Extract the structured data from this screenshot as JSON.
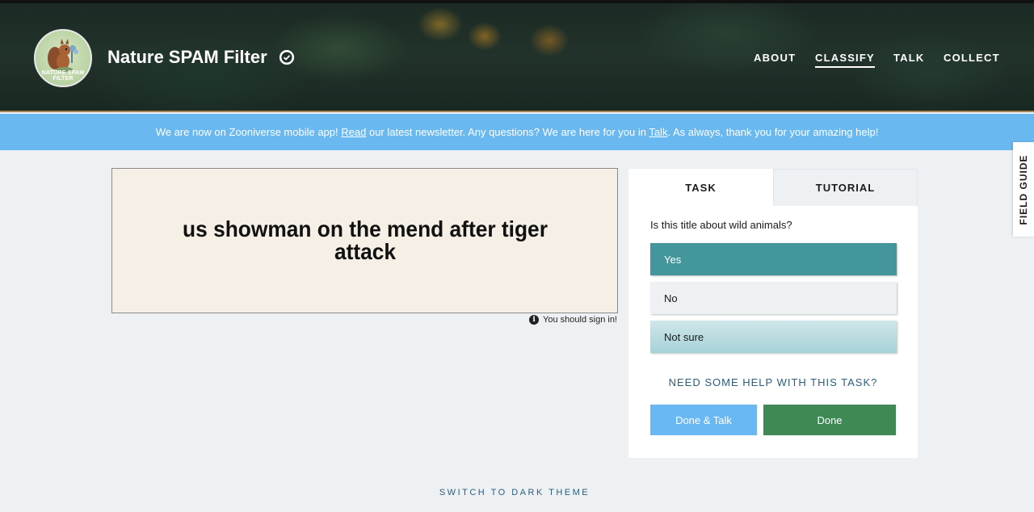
{
  "header": {
    "project_title": "Nature SPAM Filter",
    "logo_text": "NATURE SPAM FILTER",
    "nav": [
      {
        "label": "ABOUT"
      },
      {
        "label": "CLASSIFY",
        "active": true
      },
      {
        "label": "TALK"
      },
      {
        "label": "COLLECT"
      }
    ]
  },
  "banner": {
    "part1": "We are now on Zooniverse mobile app! ",
    "link1": "Read",
    "part2": " our latest newsletter. Any questions? We are here for you in ",
    "link2": "Talk",
    "part3": ". As always, thank you for your amazing help!",
    "color": "#6ab8f0"
  },
  "subject": {
    "text": "us showman on the mend after tiger attack",
    "signin_note": "You should sign in!"
  },
  "task_panel": {
    "tabs": [
      {
        "label": "TASK",
        "active": true
      },
      {
        "label": "TUTORIAL"
      }
    ],
    "question": "Is this title about wild animals?",
    "answers": [
      {
        "label": "Yes",
        "selected": true
      },
      {
        "label": "No"
      },
      {
        "label": "Not sure"
      }
    ],
    "help_text": "NEED SOME HELP WITH THIS TASK?",
    "done_talk_label": "Done & Talk",
    "done_label": "Done",
    "colors": {
      "selected": "#43979c",
      "done": "#3f8a54",
      "done_talk": "#69b7f3"
    }
  },
  "field_guide": {
    "label": "FIELD GUIDE"
  },
  "footer": {
    "theme_toggle": "SWITCH TO DARK THEME"
  }
}
